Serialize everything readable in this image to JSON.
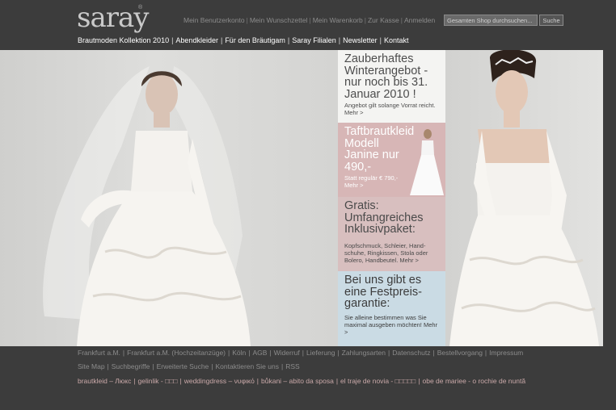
{
  "header": {
    "logo_text": "saray",
    "logo_mark": "®",
    "account_links": [
      "Mein Benutzerkonto",
      "Mein Wunschzettel",
      "Mein Warenkorb",
      "Zur Kasse",
      "Anmelden"
    ],
    "search": {
      "placeholder": "Gesamten Shop durchsuchen...",
      "button": "Suche"
    }
  },
  "main_nav": [
    "Brautmoden Kollektion 2010",
    "Abendkleider",
    "Für den Bräutigam",
    "Saray Filialen",
    "Newsletter",
    "Kontakt"
  ],
  "panels": {
    "winter": {
      "headline": "Zauberhaftes Winterangebot - nur noch bis 31. Januar 2010 !",
      "detail": "Angebot gilt solange Vorrat reicht.",
      "more": "Mehr >"
    },
    "taft": {
      "headline": "Taftbrautkleid Modell Janine nur 490,-",
      "detail": "Statt regulär € 790,-",
      "more": "Mehr >"
    },
    "gratis": {
      "headline": "Gratis: Umfangreiches Inklusivpaket:",
      "detail": "Kopfschmuck, Schleier, Hand-schuhe, Ringkissen, Stola oder Bolero, Handbeutel.",
      "more": "Mehr >"
    },
    "festpreis": {
      "headline": "Bei uns gibt es eine Festpreis-garantie:",
      "detail": "Sie alleine bestimmen was Sie maximal ausgeben möchten!",
      "more": "Mehr >"
    }
  },
  "footer": {
    "line1": [
      "Frankfurt a.M.",
      "Frankfurt a.M. (Hochzeitanzüge)",
      "Köln",
      "AGB",
      "Widerruf",
      "Lieferung",
      "Zahlungsarten",
      "Datenschutz",
      "Bestellvorgang",
      "Impressum"
    ],
    "line2": [
      "Site Map",
      "Suchbegriffe",
      "Erweiterte Suche",
      "Kontaktieren Sie uns",
      "RSS"
    ],
    "line3": [
      "brautkleid – Люкс",
      "gelinlik - □□□",
      "weddingdress – νυφικό",
      "bůkani – abito da sposa",
      "el traje de novia - □□□□□",
      "obe de mariee - o rochie de nuntă"
    ]
  },
  "colors": {
    "background": "#3c3c3c",
    "nav_text": "#ffffff",
    "footer_text": "#8c8c8c",
    "footer_accent": "#caa9a9"
  }
}
